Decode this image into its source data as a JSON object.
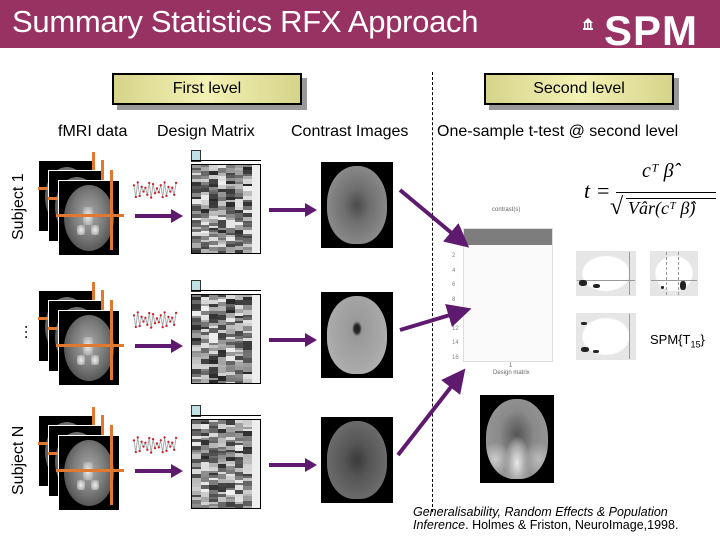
{
  "header": {
    "title": "Summary Statistics RFX Approach",
    "logo": "SPM",
    "logo_icon": "building-icon",
    "background_color": "#983263"
  },
  "levels": {
    "first": "First level",
    "second": "Second level"
  },
  "columns": {
    "fmri": "fMRI data",
    "design_matrix": "Design Matrix",
    "contrast_images": "Contrast Images",
    "ttest": "One-sample t-test @ second level"
  },
  "rows": [
    {
      "label": "Subject 1"
    },
    {
      "label": "…"
    },
    {
      "label": "Subject N"
    }
  ],
  "second_level": {
    "contrast_label": "contrast(s)",
    "design_label": "Design matrix",
    "design_x_tick": "1",
    "y_ticks": [
      "2",
      "4",
      "6",
      "8",
      "10",
      "12",
      "14",
      "16"
    ],
    "formula": {
      "lhs": "t =",
      "numerator": "cᵀ β̂",
      "denominator": "Vâr(cᵀ β̂)"
    },
    "spm_label": "SPM{T",
    "spm_subscript": "15",
    "spm_close": "}"
  },
  "citation": {
    "italic_part1": "Generalisability, Random Effects & Population",
    "italic_part2": "Inference",
    "rest": ". Holmes & Friston, NeuroImage,1998."
  },
  "colors": {
    "arrow": "#5e1a6e",
    "crosshair": "#e07830",
    "level_box": "#e8e6a4"
  }
}
